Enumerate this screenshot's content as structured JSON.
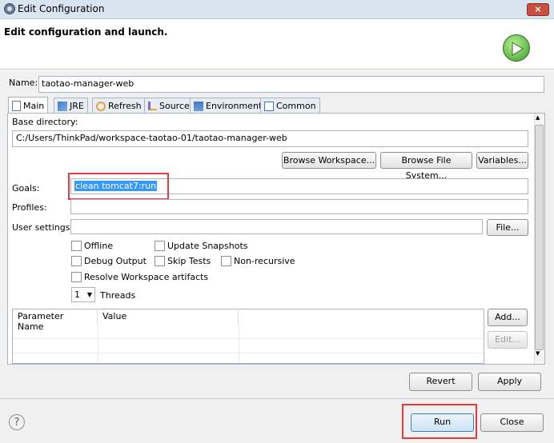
{
  "window": {
    "title": "Edit Configuration",
    "close_label": "×",
    "header_title": "Edit configuration and launch."
  },
  "name": {
    "label": "Name:",
    "value": "taotao-manager-web"
  },
  "tabs": [
    {
      "label": "Main",
      "icon": "main-tab-icon"
    },
    {
      "label": "JRE",
      "icon": "jre-icon"
    },
    {
      "label": "Refresh",
      "icon": "refresh-icon"
    },
    {
      "label": "Source",
      "icon": "source-icon"
    },
    {
      "label": "Environment",
      "icon": "environment-icon"
    },
    {
      "label": "Common",
      "icon": "common-icon"
    }
  ],
  "main": {
    "base_dir_label": "Base directory:",
    "base_dir_value": "C:/Users/ThinkPad/workspace-taotao-01/taotao-manager-web",
    "browse_workspace": "Browse Workspace...",
    "browse_fs": "Browse File System...",
    "variables": "Variables...",
    "goals_label": "Goals:",
    "goals_value": "clean tomcat7:run",
    "profiles_label": "Profiles:",
    "profiles_value": "",
    "user_settings_label": "User settings:",
    "user_settings_value": "",
    "file_button": "File...",
    "offline": "Offline",
    "update_snapshots": "Update Snapshots",
    "debug_output": "Debug Output",
    "skip_tests": "Skip Tests",
    "non_recursive": "Non-recursive",
    "resolve_workspace": "Resolve Workspace artifacts",
    "threads_value": "1",
    "threads_label": "Threads",
    "table_headers": [
      "Parameter Name",
      "Value"
    ],
    "add_button": "Add...",
    "edit_button": "Edit..."
  },
  "bottom": {
    "revert": "Revert",
    "apply": "Apply",
    "run": "Run",
    "close": "Close",
    "help_icon": "help-icon"
  }
}
